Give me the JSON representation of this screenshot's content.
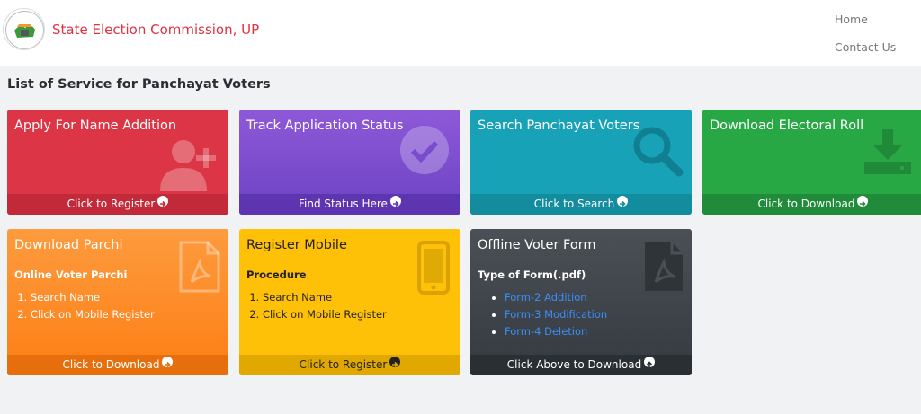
{
  "header": {
    "brand": "State Election Commission, UP",
    "nav": {
      "home": "Home",
      "contact": "Contact Us"
    }
  },
  "page_title": "List of Service for Panchayat Voters",
  "cards": {
    "name_addition": {
      "title": "Apply For Name Addition",
      "footer": "Click to Register",
      "icon": "user-plus-icon",
      "color": "#dc3545"
    },
    "track_status": {
      "title": "Track Application Status",
      "footer": "Find Status Here",
      "icon": "check-circle-icon",
      "color": "#6f42c1"
    },
    "search_voters": {
      "title": "Search Panchayat Voters",
      "footer": "Click to Search",
      "icon": "search-icon",
      "color": "#17a2b8"
    },
    "electoral_roll": {
      "title": "Download Electoral Roll",
      "footer": "Click to Download",
      "icon": "download-icon",
      "color": "#28a745"
    },
    "parchi": {
      "title": "Download Parchi",
      "subtitle": "Online Voter Parchi",
      "steps": [
        "Search Name",
        "Click on Mobile Register"
      ],
      "footer": "Click to Download",
      "icon": "pdf-file-icon",
      "color": "#fd7e14"
    },
    "register_mobile": {
      "title": "Register Mobile",
      "subtitle": "Procedure",
      "steps": [
        "Search Name",
        "Click on Mobile Register"
      ],
      "footer": "Click to Register",
      "icon": "mobile-phone-icon",
      "color": "#ffc107"
    },
    "offline_form": {
      "title": "Offline Voter Form",
      "subtitle": "Type of Form(.pdf)",
      "links": [
        "Form-2 Addition",
        "Form-3 Modification",
        "Form-4 Deletion"
      ],
      "footer": "Click Above to Download",
      "icon": "pdf-file-icon",
      "color": "#343a40"
    }
  }
}
